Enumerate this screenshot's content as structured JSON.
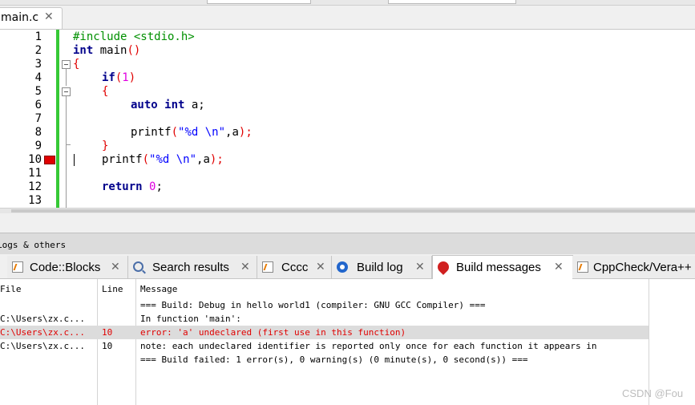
{
  "editor": {
    "file_tab": "main.c",
    "line_numbers": [
      "1",
      "2",
      "3",
      "4",
      "5",
      "6",
      "7",
      "8",
      "9",
      "10",
      "11",
      "12",
      "13"
    ],
    "code": {
      "l1": "#include <stdio.h>",
      "l2_kw": "int",
      "l2_fn": " main",
      "l2_br": "()",
      "l3": "{",
      "l4_kw": "if",
      "l4_b1": "(",
      "l4_num": "1",
      "l4_b2": ")",
      "l5": "{",
      "l6_kw": "auto int",
      "l6_rest": " a;",
      "l8_fn": "printf",
      "l8_b1": "(",
      "l8_str": "\"%d \\n\"",
      "l8_rest": ",a",
      "l8_b2": ");",
      "l9": "}",
      "l10_fn": "printf",
      "l10_b1": "(",
      "l10_str": "\"%d \\n\"",
      "l10_rest": ",a",
      "l10_b2": ");",
      "l12_kw": "return",
      "l12_num": " 0",
      "l12_rest": ";"
    }
  },
  "panel": {
    "title": "Logs & others",
    "tabs": [
      {
        "label": "Code::Blocks",
        "icon": "doc-icon"
      },
      {
        "label": "Search results",
        "icon": "search-icon"
      },
      {
        "label": "Cccc",
        "icon": "doc-icon"
      },
      {
        "label": "Build log",
        "icon": "gear-icon"
      },
      {
        "label": "Build messages",
        "icon": "pin-icon"
      },
      {
        "label": "CppCheck/Vera++",
        "icon": "doc-icon"
      }
    ],
    "close_glyph": "✕",
    "columns": {
      "file": "File",
      "line": "Line",
      "message": "Message"
    },
    "rows": [
      {
        "file": "",
        "line": "",
        "message": "=== Build: Debug in hello world1 (compiler: GNU GCC Compiler) ==="
      },
      {
        "file": "C:\\Users\\zx.c...",
        "line": "",
        "message": "In function 'main':"
      },
      {
        "file": "C:\\Users\\zx.c...",
        "line": "10",
        "message": "error: 'a' undeclared (first use in this function)"
      },
      {
        "file": "C:\\Users\\zx.c...",
        "line": "10",
        "message": "note: each undeclared identifier is reported only once for each function it appears in"
      },
      {
        "file": "",
        "line": "",
        "message": "=== Build failed: 1 error(s), 0 warning(s) (0 minute(s), 0 second(s)) ==="
      }
    ]
  },
  "watermark": "CSDN @Fou",
  "colors": {
    "change_bar": "#36c936",
    "error_text": "#e00000",
    "error_marker": "#e00000"
  }
}
